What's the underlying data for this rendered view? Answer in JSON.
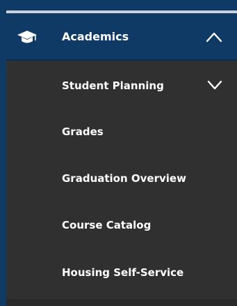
{
  "menu": {
    "header": {
      "icon": "graduation-cap-icon",
      "label": "Academics",
      "chevron": "chevron-up-icon",
      "expanded": true
    },
    "items": [
      {
        "label": "Student Planning",
        "chevron": "chevron-down-icon"
      },
      {
        "label": "Grades"
      },
      {
        "label": "Graduation Overview"
      },
      {
        "label": "Course Catalog"
      },
      {
        "label": "Housing Self-Service"
      }
    ]
  },
  "colors": {
    "navy": "#0f3a66",
    "panel": "#303030",
    "text": "#ffffff"
  }
}
